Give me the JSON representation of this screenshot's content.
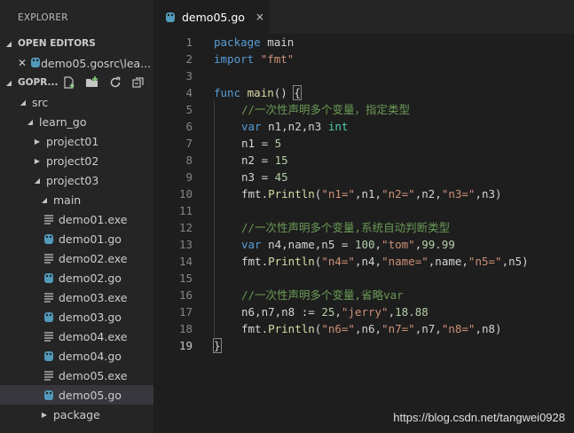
{
  "sidebar": {
    "title": "EXPLORER",
    "open_editors_label": "OPEN EDITORS",
    "open_editor": {
      "name": "demo05.go",
      "path": "src\\lea..."
    },
    "project_label": "GOPR...",
    "tree": [
      {
        "label": "src",
        "kind": "folder-open",
        "depth": 0
      },
      {
        "label": "learn_go",
        "kind": "folder-open",
        "depth": 1
      },
      {
        "label": "project01",
        "kind": "folder-closed",
        "depth": 2
      },
      {
        "label": "project02",
        "kind": "folder-closed",
        "depth": 2
      },
      {
        "label": "project03",
        "kind": "folder-open",
        "depth": 2
      },
      {
        "label": "main",
        "kind": "folder-open",
        "depth": 3
      },
      {
        "label": "demo01.exe",
        "kind": "exe",
        "depth": 4
      },
      {
        "label": "demo01.go",
        "kind": "go",
        "depth": 4
      },
      {
        "label": "demo02.exe",
        "kind": "exe",
        "depth": 4
      },
      {
        "label": "demo02.go",
        "kind": "go",
        "depth": 4
      },
      {
        "label": "demo03.exe",
        "kind": "exe",
        "depth": 4
      },
      {
        "label": "demo03.go",
        "kind": "go",
        "depth": 4
      },
      {
        "label": "demo04.exe",
        "kind": "exe",
        "depth": 4
      },
      {
        "label": "demo04.go",
        "kind": "go",
        "depth": 4
      },
      {
        "label": "demo05.exe",
        "kind": "exe",
        "depth": 4
      },
      {
        "label": "demo05.go",
        "kind": "go",
        "depth": 4,
        "selected": true
      },
      {
        "label": "package",
        "kind": "folder-closed",
        "depth": 3
      }
    ]
  },
  "tab": {
    "name": "demo05.go",
    "close": "×"
  },
  "editor": {
    "current_line": 19,
    "lines": [
      {
        "n": "1",
        "t": [
          [
            "kw",
            "package"
          ],
          [
            "p",
            " main"
          ]
        ]
      },
      {
        "n": "2",
        "t": [
          [
            "kw",
            "import"
          ],
          [
            "p",
            " "
          ],
          [
            "str",
            "\"fmt\""
          ]
        ]
      },
      {
        "n": "3",
        "t": []
      },
      {
        "n": "4",
        "t": [
          [
            "kw",
            "func"
          ],
          [
            "p",
            " "
          ],
          [
            "fn",
            "main"
          ],
          [
            "p",
            "() "
          ],
          [
            "br",
            "{"
          ]
        ]
      },
      {
        "n": "5",
        "i": 1,
        "t": [
          [
            "cm",
            "//一次性声明多个变量，指定类型"
          ]
        ]
      },
      {
        "n": "6",
        "i": 1,
        "t": [
          [
            "kw",
            "var"
          ],
          [
            "p",
            " n1,n2,n3 "
          ],
          [
            "ty",
            "int"
          ]
        ]
      },
      {
        "n": "7",
        "i": 1,
        "t": [
          [
            "p",
            "n1 = "
          ],
          [
            "num",
            "5"
          ]
        ]
      },
      {
        "n": "8",
        "i": 1,
        "t": [
          [
            "p",
            "n2 = "
          ],
          [
            "num",
            "15"
          ]
        ]
      },
      {
        "n": "9",
        "i": 1,
        "t": [
          [
            "p",
            "n3 = "
          ],
          [
            "num",
            "45"
          ]
        ]
      },
      {
        "n": "10",
        "i": 1,
        "t": [
          [
            "p",
            "fmt."
          ],
          [
            "fn",
            "Println"
          ],
          [
            "p",
            "("
          ],
          [
            "str",
            "\"n1=\""
          ],
          [
            "p",
            ",n1,"
          ],
          [
            "str",
            "\"n2=\""
          ],
          [
            "p",
            ",n2,"
          ],
          [
            "str",
            "\"n3=\""
          ],
          [
            "p",
            ",n3)"
          ]
        ]
      },
      {
        "n": "11",
        "i": 1,
        "t": []
      },
      {
        "n": "12",
        "i": 1,
        "t": [
          [
            "cm",
            "//一次性声明多个变量,系统自动判断类型"
          ]
        ]
      },
      {
        "n": "13",
        "i": 1,
        "t": [
          [
            "kw",
            "var"
          ],
          [
            "p",
            " n4,name,n5 = "
          ],
          [
            "num",
            "100"
          ],
          [
            "p",
            ","
          ],
          [
            "str",
            "\"tom\""
          ],
          [
            "p",
            ","
          ],
          [
            "num",
            "99.99"
          ]
        ]
      },
      {
        "n": "14",
        "i": 1,
        "t": [
          [
            "p",
            "fmt."
          ],
          [
            "fn",
            "Println"
          ],
          [
            "p",
            "("
          ],
          [
            "str",
            "\"n4=\""
          ],
          [
            "p",
            ",n4,"
          ],
          [
            "str",
            "\"name=\""
          ],
          [
            "p",
            ",name,"
          ],
          [
            "str",
            "\"n5=\""
          ],
          [
            "p",
            ",n5)"
          ]
        ]
      },
      {
        "n": "15",
        "i": 1,
        "t": []
      },
      {
        "n": "16",
        "i": 1,
        "t": [
          [
            "cm",
            "//一次性声明多个变量,省略var"
          ]
        ]
      },
      {
        "n": "17",
        "i": 1,
        "t": [
          [
            "p",
            "n6,n7,n8 := "
          ],
          [
            "num",
            "25"
          ],
          [
            "p",
            ","
          ],
          [
            "str",
            "\"jerry\""
          ],
          [
            "p",
            ","
          ],
          [
            "num",
            "18.88"
          ]
        ]
      },
      {
        "n": "18",
        "i": 1,
        "t": [
          [
            "p",
            "fmt."
          ],
          [
            "fn",
            "Println"
          ],
          [
            "p",
            "("
          ],
          [
            "str",
            "\"n6=\""
          ],
          [
            "p",
            ",n6,"
          ],
          [
            "str",
            "\"n7=\""
          ],
          [
            "p",
            ",n7,"
          ],
          [
            "str",
            "\"n8=\""
          ],
          [
            "p",
            ",n8)"
          ]
        ]
      },
      {
        "n": "19",
        "t": [
          [
            "br",
            "}"
          ]
        ]
      }
    ]
  },
  "watermark": "https://blog.csdn.net/tangwei0928",
  "colors": {
    "go_icon": "#519aba",
    "folder_accent": "#c5c5c5"
  }
}
